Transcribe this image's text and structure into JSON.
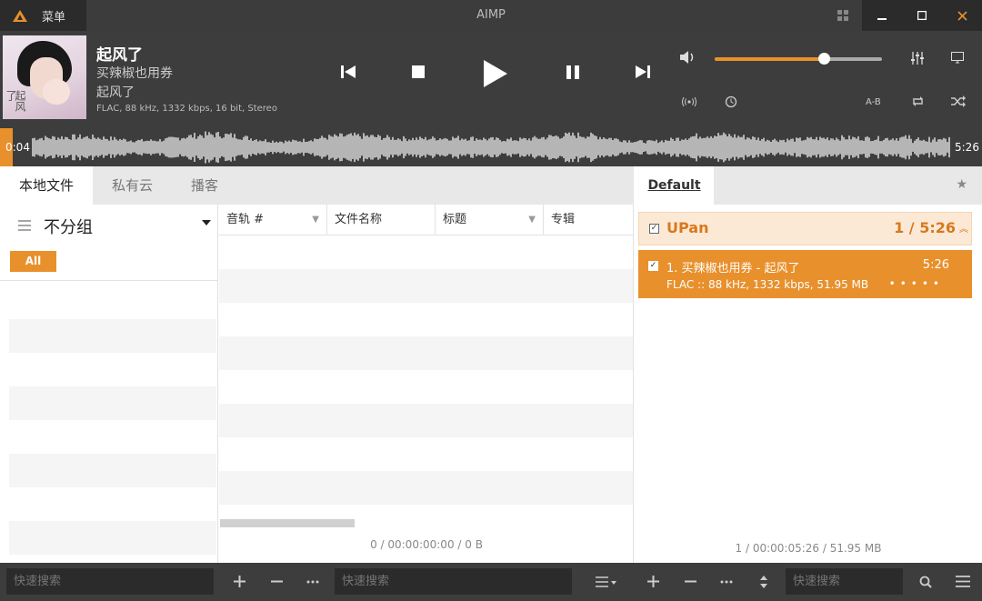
{
  "titlebar": {
    "menu_label": "菜单",
    "app_title": "AIMP"
  },
  "now_playing": {
    "title": "起风了",
    "artist": "买辣椒也用券",
    "album": "起风了",
    "tech_info": "FLAC, 88 kHz, 1332 kbps, 16 bit, Stereo",
    "cover_script": "起风了"
  },
  "transport": {
    "volume_level": 0.65,
    "ab_label": "A-B"
  },
  "waveform": {
    "position": "0:04",
    "duration": "5:26",
    "progress": 0.012
  },
  "library": {
    "tabs": [
      "本地文件",
      "私有云",
      "播客"
    ],
    "grouping_label": "不分组",
    "all_label": "All",
    "columns": [
      {
        "label": "音轨 #",
        "filter": true
      },
      {
        "label": "文件名称",
        "filter": false
      },
      {
        "label": "标题",
        "filter": true
      },
      {
        "label": "专辑",
        "filter": false
      }
    ],
    "status": "0 / 00:00:00:00 / 0 B"
  },
  "playlist": {
    "tab_label": "Default",
    "group": {
      "name": "UPan",
      "count": "1 / 5:26"
    },
    "tracks": [
      {
        "title": "1. 买辣椒也用券 - 起风了",
        "duration": "5:26",
        "info": "FLAC :: 88 kHz, 1332 kbps, 51.95 MB",
        "rating": "•••••"
      }
    ],
    "status": "1 / 00:00:05:26 / 51.95 MB"
  },
  "bottombar": {
    "search_placeholder_1": "快速搜索",
    "search_placeholder_2": "快速搜索",
    "search_placeholder_3": "快速搜索"
  },
  "colors": {
    "accent": "#e8902c",
    "dark_bg": "#3d3d3d",
    "darker_bg": "#2b2b2b"
  }
}
